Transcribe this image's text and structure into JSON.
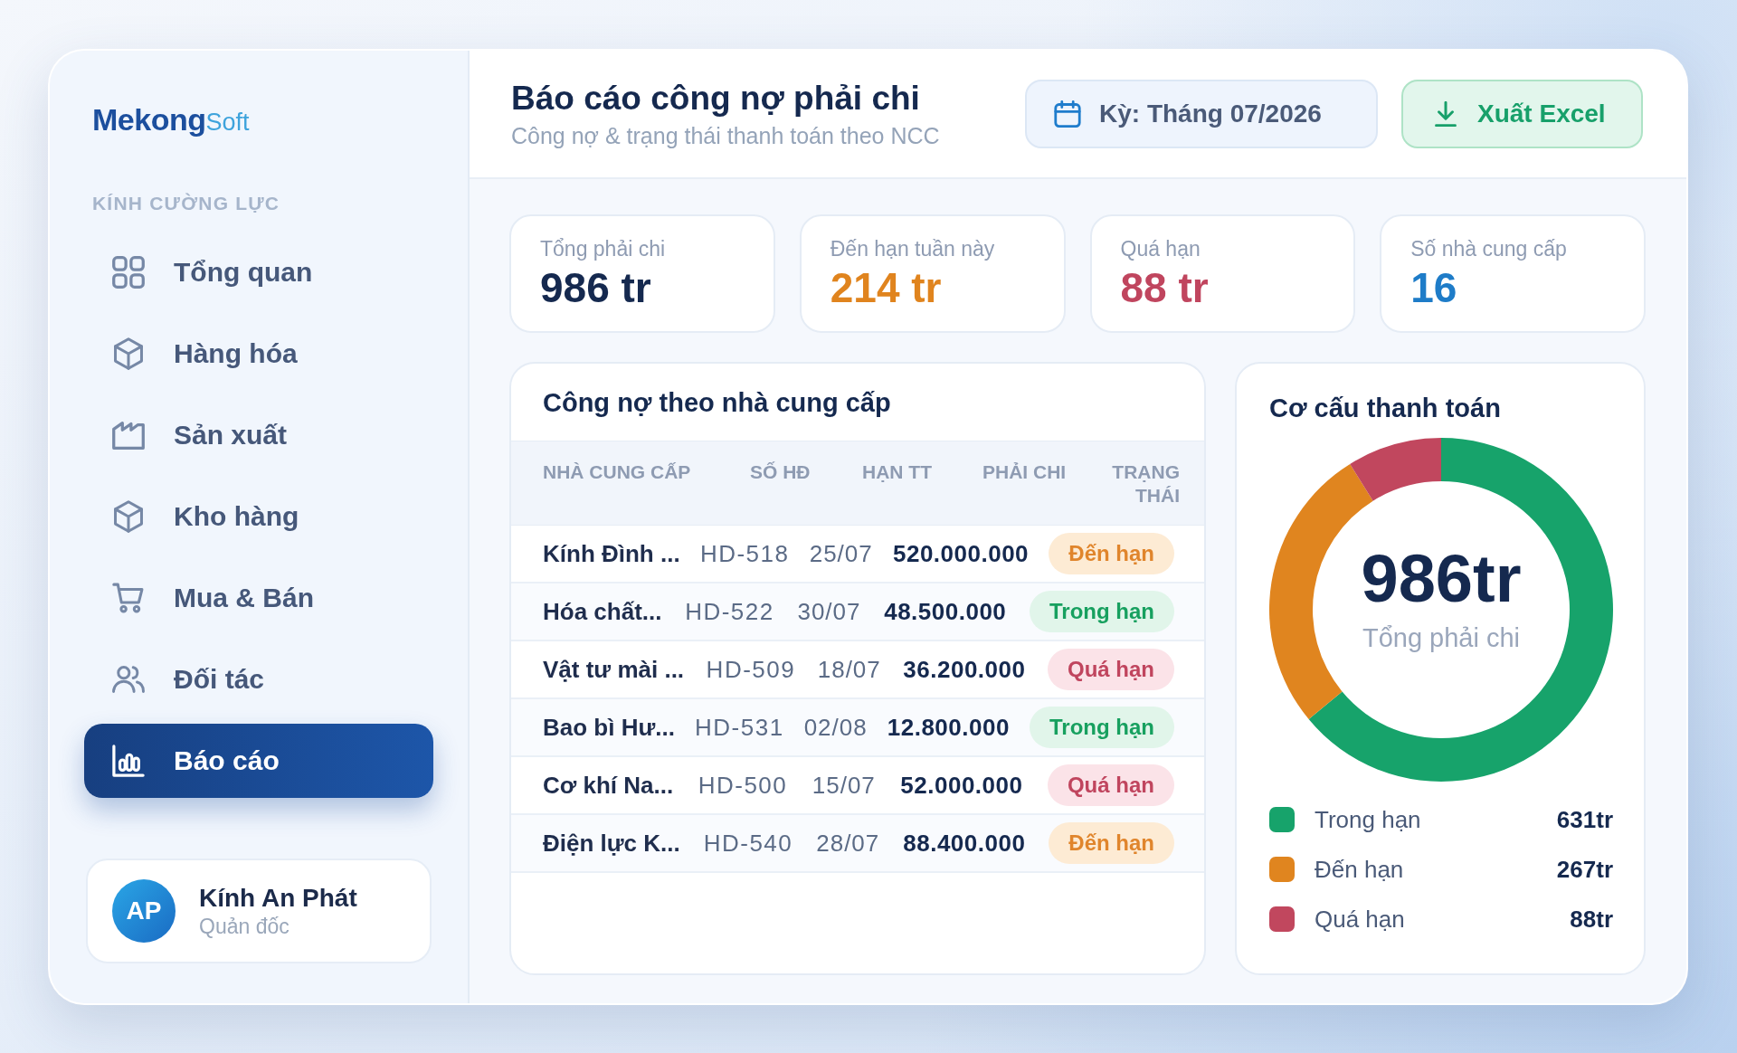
{
  "sidebar": {
    "logo": {
      "primary": "Mekong",
      "secondary": "Soft"
    },
    "section_label": "KÍNH CƯỜNG LỰC",
    "items": [
      {
        "label": "Tổng quan",
        "selected": false
      },
      {
        "label": "Hàng hóa",
        "selected": false
      },
      {
        "label": "Sản xuất",
        "selected": false
      },
      {
        "label": "Kho hàng",
        "selected": false
      },
      {
        "label": "Mua & Bán",
        "selected": false
      },
      {
        "label": "Đối tác",
        "selected": false
      },
      {
        "label": "Báo cáo",
        "selected": true
      }
    ],
    "user": {
      "initials": "AP",
      "name": "Kính An Phát",
      "role": "Quản đốc"
    }
  },
  "header": {
    "title": "Báo cáo công nợ phải chi",
    "subtitle": "Công nợ & trạng thái thanh toán theo NCC",
    "period_button": "Kỳ: Tháng 07/2026",
    "export_button": "Xuất Excel"
  },
  "kpis": [
    {
      "label": "Tổng phải chi",
      "value": "986 tr",
      "kind": "neutral"
    },
    {
      "label": "Đến hạn tuần này",
      "value": "214 tr",
      "kind": "warning"
    },
    {
      "label": "Quá hạn",
      "value": "88 tr",
      "kind": "danger"
    },
    {
      "label": "Số nhà cung cấp",
      "value": "16",
      "kind": "info"
    }
  ],
  "supplier_table": {
    "title": "Công nợ theo nhà cung cấp",
    "columns": [
      "NHÀ CUNG CẤP",
      "SỐ HĐ",
      "HẠN TT",
      "PHẢI CHI",
      "TRẠNG THÁI"
    ],
    "rows": [
      {
        "supplier": "Kính Đình ...",
        "invoice": "HD-518",
        "due_date": "25/07",
        "amount": "520.000.000",
        "status": {
          "label": "Đến hạn",
          "kind": "due"
        }
      },
      {
        "supplier": "Hóa chất...",
        "invoice": "HD-522",
        "due_date": "30/07",
        "amount": "48.500.000",
        "status": {
          "label": "Trong hạn",
          "kind": "ok"
        }
      },
      {
        "supplier": "Vật tư mài ...",
        "invoice": "HD-509",
        "due_date": "18/07",
        "amount": "36.200.000",
        "status": {
          "label": "Quá hạn",
          "kind": "overdue"
        }
      },
      {
        "supplier": "Bao bì Hư...",
        "invoice": "HD-531",
        "due_date": "02/08",
        "amount": "12.800.000",
        "status": {
          "label": "Trong hạn",
          "kind": "ok"
        }
      },
      {
        "supplier": "Cơ khí Na...",
        "invoice": "HD-500",
        "due_date": "15/07",
        "amount": "52.000.000",
        "status": {
          "label": "Quá hạn",
          "kind": "overdue"
        }
      },
      {
        "supplier": "Điện lực K...",
        "invoice": "HD-540",
        "due_date": "28/07",
        "amount": "88.400.000",
        "status": {
          "label": "Đến hạn",
          "kind": "due"
        }
      }
    ]
  },
  "payment_structure": {
    "title": "Cơ cấu thanh toán",
    "center_value": "986tr",
    "center_label": "Tổng phải chi",
    "chart_data": {
      "type": "donut",
      "categories": [
        "Trong hạn",
        "Đến hạn",
        "Quá hạn"
      ],
      "values": [
        64.0,
        27.1,
        8.9
      ]
    },
    "legend": [
      {
        "value": "631tr",
        "color": "#17a36b"
      },
      {
        "value": "267tr",
        "color": "#e0851f"
      },
      {
        "value": "88tr",
        "color": "#c1475e"
      }
    ]
  }
}
